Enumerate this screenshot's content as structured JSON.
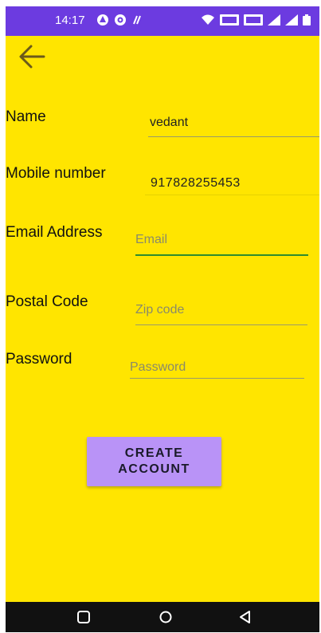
{
  "status_bar": {
    "time": "14:17",
    "left_icons": [
      "assistant-icon",
      "vpn-icon",
      "nfc-icon"
    ],
    "right_icons": [
      "wifi-icon",
      "volte1-icon",
      "volte2-icon",
      "signal-icon",
      "signal-icon",
      "battery-icon"
    ],
    "color": "#6C3BE0"
  },
  "form": {
    "name_label": "Name",
    "name_value": "vedant",
    "mobile_label": "Mobile number",
    "mobile_value": "917828255453",
    "email_label": "Email Address",
    "email_placeholder": "Email",
    "postal_label": "Postal Code",
    "postal_placeholder": "Zip code",
    "password_label": "Password",
    "password_placeholder": "Password"
  },
  "button": {
    "label": "CREATE ACCOUNT"
  },
  "colors": {
    "background": "#FFE500",
    "button": "#B993F7",
    "focus_underline": "#2E8B2E",
    "nav_bar": "#111111"
  },
  "nav_bar": {
    "icons": [
      "recents-icon",
      "home-icon",
      "back-nav-icon"
    ]
  }
}
